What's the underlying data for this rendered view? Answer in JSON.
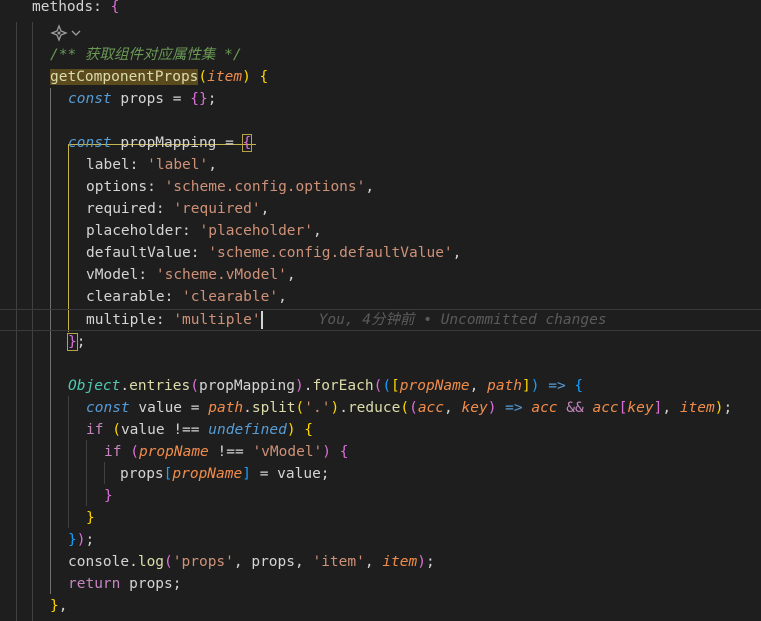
{
  "editor": {
    "blame_text": "You, 4分钟前 • Uncommitted changes",
    "lines": {
      "l0": {
        "kw": "methods",
        "p": ": ",
        "b": "{"
      },
      "l2": "/** 获取组件对应属性集 */",
      "l3": {
        "fn": "getComponentProps",
        "open": "(",
        "param": "item",
        "close": ")",
        "sp": " ",
        "brace": "{"
      },
      "l4": {
        "kw": "const",
        "rest": " props = ",
        "br": "{}",
        "semi": ";"
      },
      "l6": {
        "kw": "const",
        "rest": " propMapping = ",
        "brace": "{"
      },
      "l7": {
        "key": "label",
        "colon": ": ",
        "val": "'label'",
        "comma": ","
      },
      "l8": {
        "key": "options",
        "colon": ": ",
        "val": "'scheme.config.options'",
        "comma": ","
      },
      "l9": {
        "key": "required",
        "colon": ": ",
        "val": "'required'",
        "comma": ","
      },
      "l10": {
        "key": "placeholder",
        "colon": ": ",
        "val": "'placeholder'",
        "comma": ","
      },
      "l11": {
        "key": "defaultValue",
        "colon": ": ",
        "val": "'scheme.config.defaultValue'",
        "comma": ","
      },
      "l12": {
        "key": "vModel",
        "colon": ": ",
        "val": "'scheme.vModel'",
        "comma": ","
      },
      "l13": {
        "key": "clearable",
        "colon": ": ",
        "val": "'clearable'",
        "comma": ","
      },
      "l14": {
        "key": "multiple",
        "colon": ": ",
        "val": "'multiple'"
      },
      "l15": {
        "brace": "}",
        "semi": ";"
      },
      "l17": {
        "cls": "Object",
        "dot1": ".",
        "fn1": "entries",
        "p1": "(",
        "arg": "propMapping",
        "p2": ")",
        "dot2": ".",
        "fn2": "forEach",
        "p3": "(",
        "p4": "(",
        "b1": "[",
        "param1": "propName",
        "comma": ", ",
        "param2": "path",
        "b2": "]",
        "p5": ")",
        "arrow": " => ",
        "brace": "{"
      },
      "l18": {
        "kw": "const",
        "v": " value = ",
        "obj": "path",
        "dot": ".",
        "fn1": "split",
        "p1": "(",
        "s": "'.'",
        "p2": ")",
        "dot2": ".",
        "fn2": "reduce",
        "p3": "(",
        "p4": "(",
        "a1": "acc",
        "c1": ", ",
        "a2": "key",
        "p5": ")",
        "arrow": " => ",
        "a3": "acc",
        "and": " && ",
        "a4": "acc",
        "b1": "[",
        "a5": "key",
        "b2": "]",
        "c2": ", ",
        "a6": "item",
        "p6": ")",
        "semi": ";"
      },
      "l19": {
        "kw": "if",
        "sp": " ",
        "p1": "(",
        "v": "value",
        "op": " !== ",
        "u": "undefined",
        "p2": ")",
        "sp2": " ",
        "brace": "{"
      },
      "l20": {
        "kw": "if",
        "sp": " ",
        "p1": "(",
        "v": "propName",
        "op": " !== ",
        "s": "'vModel'",
        "p2": ")",
        "sp2": " ",
        "brace": "{"
      },
      "l21": {
        "v": "props",
        "b1": "[",
        "k": "propName",
        "b2": "]",
        "rest": " = value;"
      },
      "l22": "}",
      "l23": "}",
      "l24": {
        "brace": "}",
        "paren": ")",
        "semi": ";"
      },
      "l25": {
        "obj": "console",
        "dot": ".",
        "fn": "log",
        "p1": "(",
        "s1": "'props'",
        "c1": ", props, ",
        "s2": "'item'",
        "c2": ", ",
        "a": "item",
        "p2": ")",
        "semi": ";"
      },
      "l26": {
        "kw": "return",
        "rest": " props;"
      },
      "l27": {
        "brace": "}",
        "comma": ","
      }
    }
  }
}
